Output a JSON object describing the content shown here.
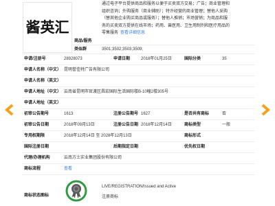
{
  "mark": {
    "text": "酱英汇"
  },
  "goods": {
    "label": "商品/服务",
    "text": "通过电子平台提供商品和服务以便于买卖双方交易；广告；商业管理和组织咨询；外购服务（商业辅助）；特许经营的商业管理；替他人采购（替其他企业购买商品或服务）；替他人推销；市场营销；为商品和服务的买卖双方提供在线市场；药用、兽医用、卫生用制剂和医疗用品的零售服务",
    "more_link": "查看详细信息"
  },
  "similar_groups": {
    "label": "类似群",
    "value": "3501;3502;3503;3509;"
  },
  "details": {
    "reg_no": {
      "label": "申请/注册号",
      "value": "28928073"
    },
    "app_date": {
      "label": "申请日期",
      "value": "2018年01月25日"
    },
    "intl_class": {
      "label": "国际分类",
      "value": "35"
    },
    "applicant_cn": {
      "label": "申请人名称（中文）",
      "value": "昆明誉佳特广告有限公司"
    },
    "applicant_en": {
      "label": "申请人名称（英文）",
      "value": ""
    },
    "address_cn": {
      "label": "申请人地址（中文）",
      "value": "云南省昆明市官渡区昌宏国际生活国际楼B-10幢2楼305号"
    },
    "address_en": {
      "label": "申请人地址（英文）",
      "value": ""
    },
    "prelim_issue": {
      "label": "初审公告期号",
      "value": "1613"
    },
    "reg_issue": {
      "label": "注册公告期号",
      "value": "1627"
    },
    "co_owned": {
      "label": "是否共有商标",
      "value": "否"
    },
    "prelim_date": {
      "label": "初审公告日期",
      "value": "2018年09月13日"
    },
    "reg_date": {
      "label": "注册公告日期",
      "value": "2018年12月14日"
    },
    "mark_type": {
      "label": "商标类型",
      "value": "一般"
    },
    "term": {
      "label": "专用权期限",
      "value": "2018年12月14日 至 2028年12月13日"
    },
    "mark_form": {
      "label": "商标形式",
      "value": ""
    },
    "intl_reg_date": {
      "label": "国际注册日期",
      "value": ""
    },
    "later_designation_date": {
      "label": "后期指定日期",
      "value": ""
    },
    "priority_date": {
      "label": "优先权日期",
      "value": ""
    },
    "agent": {
      "label": "代理/办理机构",
      "value": "云南方土实业集团股份有限公司"
    },
    "process": {
      "label": "商标流程",
      "link": "查看"
    },
    "status": {
      "label": "商标状态图标",
      "icon": "registered-seal-icon",
      "status_en": "LIVE/REGISTRATION/Issued and Active",
      "status_cn": "注册商标"
    }
  },
  "nav": {
    "prev_icon": "chevron-left-icon",
    "next_icon": "chevron-right-icon"
  },
  "colors": {
    "link": "#3b7ddd",
    "nav_arrow": "#f5a01e",
    "status_ring": "#2e9b3e",
    "status_seal": "#5a5a5a"
  }
}
